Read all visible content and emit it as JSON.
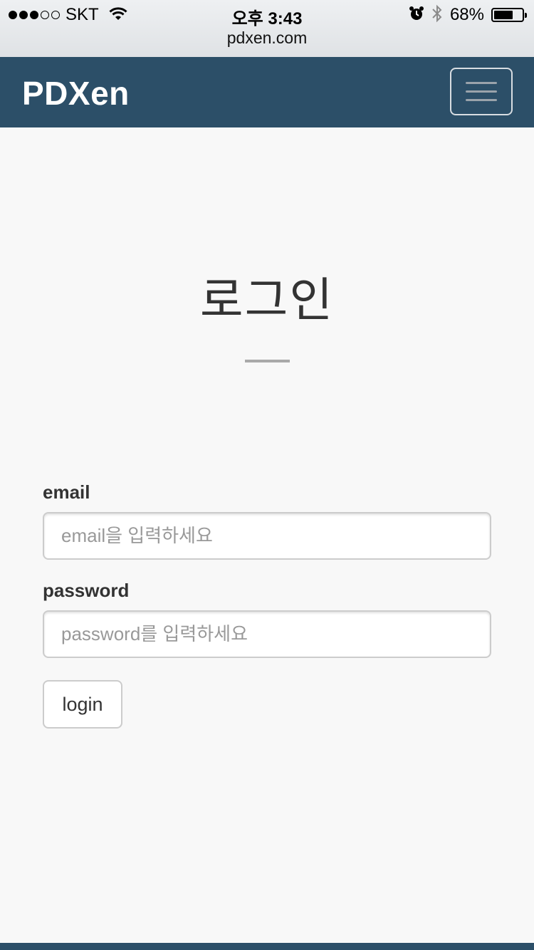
{
  "status_bar": {
    "carrier": "SKT",
    "signal_dots_filled": 3,
    "signal_dots_total": 5,
    "time": "오후 3:43",
    "battery_percent": "68%",
    "battery_level": 0.68,
    "icons": [
      "wifi-icon",
      "alarm-icon",
      "bluetooth-icon",
      "battery-icon"
    ]
  },
  "browser": {
    "url": "pdxen.com"
  },
  "navbar": {
    "brand": "PDXen",
    "background": "#2c4f68",
    "menu_icon": "hamburger-menu-icon"
  },
  "page": {
    "title": "로그인"
  },
  "form": {
    "email_label": "email",
    "email_placeholder": "email을 입력하세요",
    "email_value": "",
    "password_label": "password",
    "password_placeholder": "password를 입력하세요",
    "password_value": "",
    "submit_label": "login"
  }
}
